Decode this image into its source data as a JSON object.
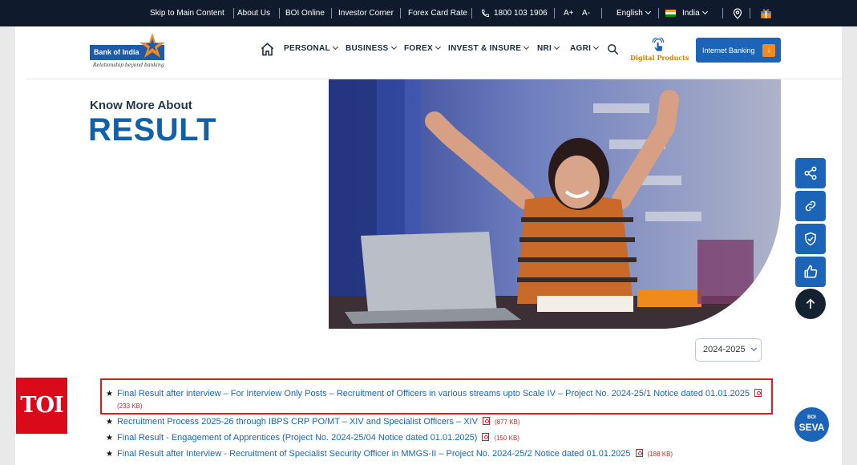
{
  "topbar": {
    "skip": "Skip to Main Content",
    "about": "About Us",
    "boi_online": "BOI Online",
    "investor": "Investor Corner",
    "forex_rate": "Forex Card Rate",
    "phone": "1800 103 1906",
    "font_plus": "A+",
    "font_minus": "A-",
    "language": "English",
    "country": "India"
  },
  "header": {
    "logo_text": "Bank of India",
    "logo_tagline": "Relationship beyond banking",
    "nav": [
      "PERSONAL",
      "BUSINESS",
      "FOREX",
      "INVEST & INSURE",
      "NRI",
      "AGRI"
    ],
    "digital_products": "Digital Products",
    "internet_banking": "Internet Banking"
  },
  "hero": {
    "kicker": "Know More About",
    "title": "RESULT"
  },
  "filter": {
    "year": "2024-2025"
  },
  "results": [
    {
      "title": "Final Result after interview – For Interview Only Posts – Recruitment of Officers in various streams upto Scale IV – Project No. 2024-25/1 Notice dated 01.01.2025",
      "size": "(233 KB)"
    },
    {
      "title": "Recruitment Process 2025-26 through IBPS CRP PO/MT – XIV and Specialist Officers – XIV",
      "size": "(877 KB)"
    },
    {
      "title": "Final Result - Engagement of Apprentices (Project No. 2024-25/04 Notice dated 01.01.2025)",
      "size": "(150 KB)"
    },
    {
      "title": "Final Result after Interview - Recruitment of Specialist Security Officer in MMGS-II – Project No. 2024-25/2 Notice dated 01.01.2025",
      "size": "(188 KB)"
    }
  ],
  "badges": {
    "toi": "TOI",
    "seva_top": "BOI",
    "seva_bottom": "SEVA"
  },
  "colors": {
    "primary": "#1c64b7",
    "topbar": "#0f1a2c",
    "highlight": "#e01b1b",
    "toi": "#d90b1b"
  }
}
